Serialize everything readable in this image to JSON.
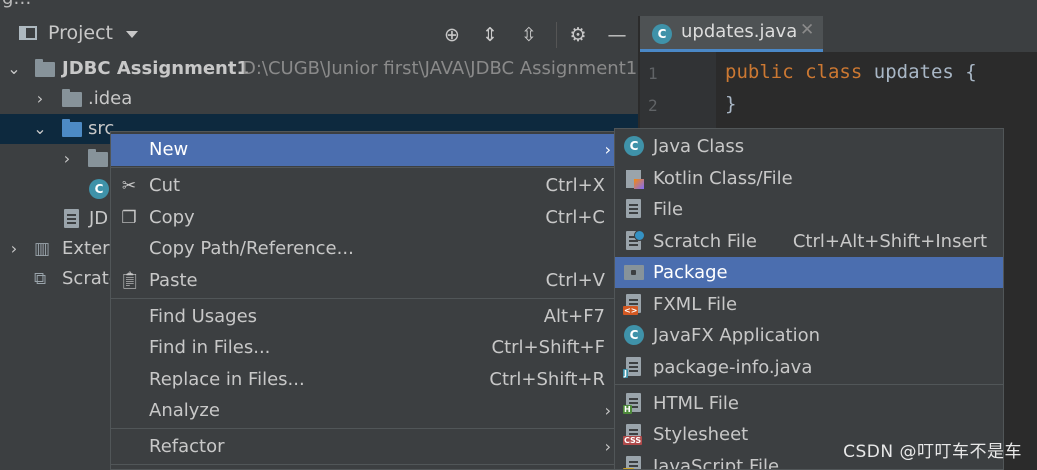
{
  "window": {
    "title_fragment": "…g…"
  },
  "project_panel": {
    "title": "Project",
    "toolbar_icons": [
      "locate-icon",
      "expand-all-icon",
      "collapse-all-icon",
      "gear-icon",
      "hide-icon"
    ],
    "tree": [
      {
        "label": "JDBC Assignment1",
        "path": "D:\\CUGB\\Junior first\\JAVA\\JDBC Assignment1"
      },
      {
        "label": ".idea"
      },
      {
        "label": "src"
      },
      {
        "label": ""
      },
      {
        "label": ""
      },
      {
        "label": "JD"
      },
      {
        "label": "Extern"
      },
      {
        "label": "Scrato"
      }
    ]
  },
  "editor": {
    "tab_label": "updates.java",
    "line_numbers": [
      "1",
      "2"
    ],
    "code": {
      "kw1": "public",
      "kw2": "class",
      "classname": "updates",
      "brace_open": "{",
      "brace_close": "}"
    }
  },
  "context_menu": {
    "items": [
      {
        "label": "New",
        "shortcut": "",
        "submenu": true,
        "icon": ""
      },
      {
        "label": "Cut",
        "shortcut": "Ctrl+X",
        "icon": "scissors-icon"
      },
      {
        "label": "Copy",
        "shortcut": "Ctrl+C",
        "icon": "copy-icon"
      },
      {
        "label": "Copy Path/Reference...",
        "shortcut": ""
      },
      {
        "label": "Paste",
        "shortcut": "Ctrl+V",
        "icon": "clipboard-icon"
      },
      {
        "label": "Find Usages",
        "shortcut": "Alt+F7"
      },
      {
        "label": "Find in Files...",
        "shortcut": "Ctrl+Shift+F"
      },
      {
        "label": "Replace in Files...",
        "shortcut": "Ctrl+Shift+R"
      },
      {
        "label": "Analyze",
        "shortcut": "",
        "submenu": true
      },
      {
        "label": "Refactor",
        "shortcut": "",
        "submenu": true
      }
    ]
  },
  "new_submenu": {
    "items": [
      {
        "label": "Java Class",
        "shortcut": ""
      },
      {
        "label": "Kotlin Class/File",
        "shortcut": ""
      },
      {
        "label": "File",
        "shortcut": ""
      },
      {
        "label": "Scratch File",
        "shortcut": "Ctrl+Alt+Shift+Insert"
      },
      {
        "label": "Package",
        "shortcut": ""
      },
      {
        "label": "FXML File",
        "shortcut": ""
      },
      {
        "label": "JavaFX Application",
        "shortcut": ""
      },
      {
        "label": "package-info.java",
        "shortcut": ""
      },
      {
        "label": "HTML File",
        "shortcut": ""
      },
      {
        "label": "Stylesheet",
        "shortcut": ""
      },
      {
        "label": "JavaScript File",
        "shortcut": ""
      }
    ],
    "badges": {
      "fxml": "<>",
      "html": "H",
      "css": "CSS",
      "js": "JS",
      "java": "J"
    }
  },
  "watermark": "CSDN @叮叮车不是车",
  "colors": {
    "highlight": "#4b6eaf",
    "selection": "#0d293e",
    "panel": "#3c3f41",
    "editor_bg": "#2b2b2b",
    "keyword": "#cc7832",
    "class_icon": "#3f92a9"
  }
}
